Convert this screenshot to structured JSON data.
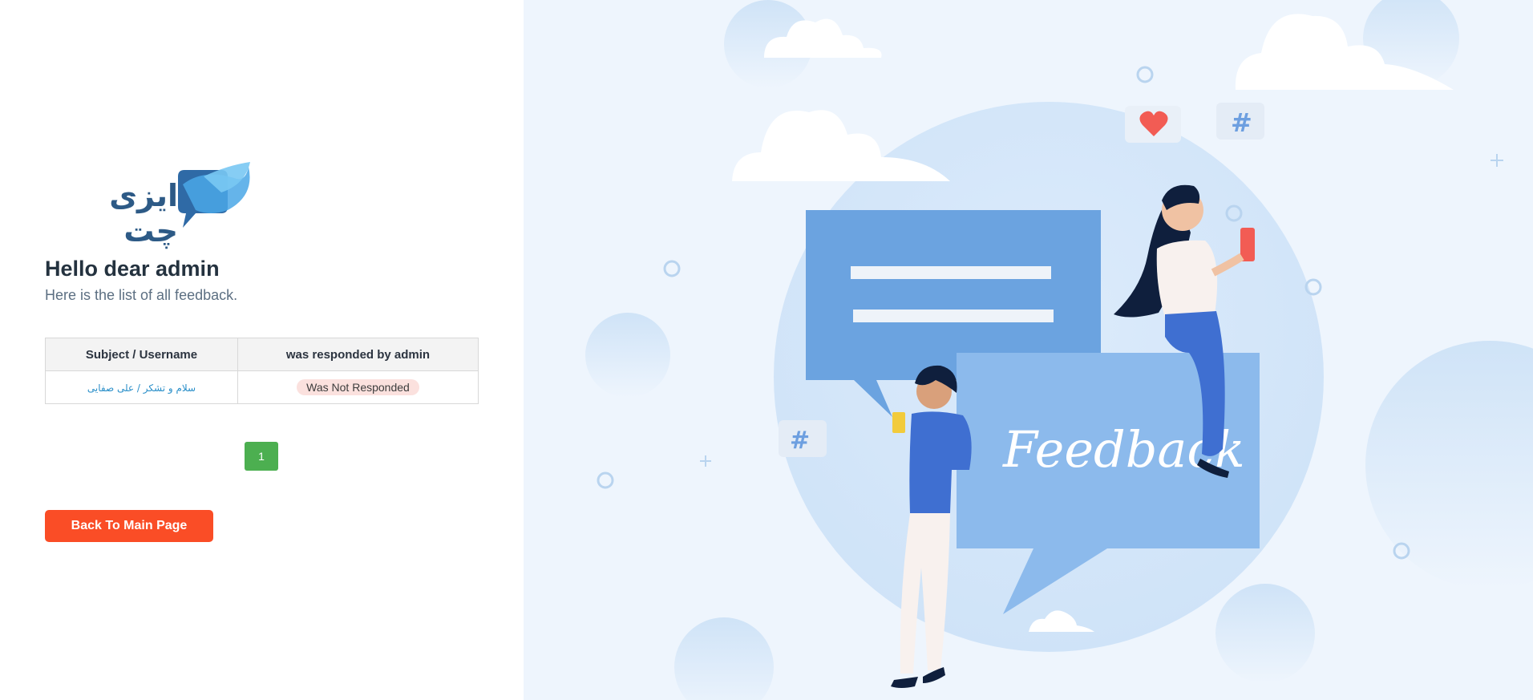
{
  "brand": {
    "logo_text": "ایزی چت"
  },
  "header": {
    "greeting": "Hello dear admin",
    "subtitle": "Here is the list of all feedback."
  },
  "table": {
    "columns": [
      "Subject / Username",
      "was responded by admin"
    ],
    "rows": [
      {
        "subject": "سلام و تشکر / علی صفایی",
        "status": "Was Not Responded"
      }
    ]
  },
  "pagination": {
    "current_page": "1"
  },
  "actions": {
    "back_label": "Back To Main Page"
  },
  "illustration": {
    "banner_text": "Feedback"
  },
  "colors": {
    "accent": "#fa4d26",
    "pager": "#4caf50",
    "link": "#2a8fc9",
    "badge_bg": "#fbe1de",
    "panel_bg": "#eef5fd"
  }
}
